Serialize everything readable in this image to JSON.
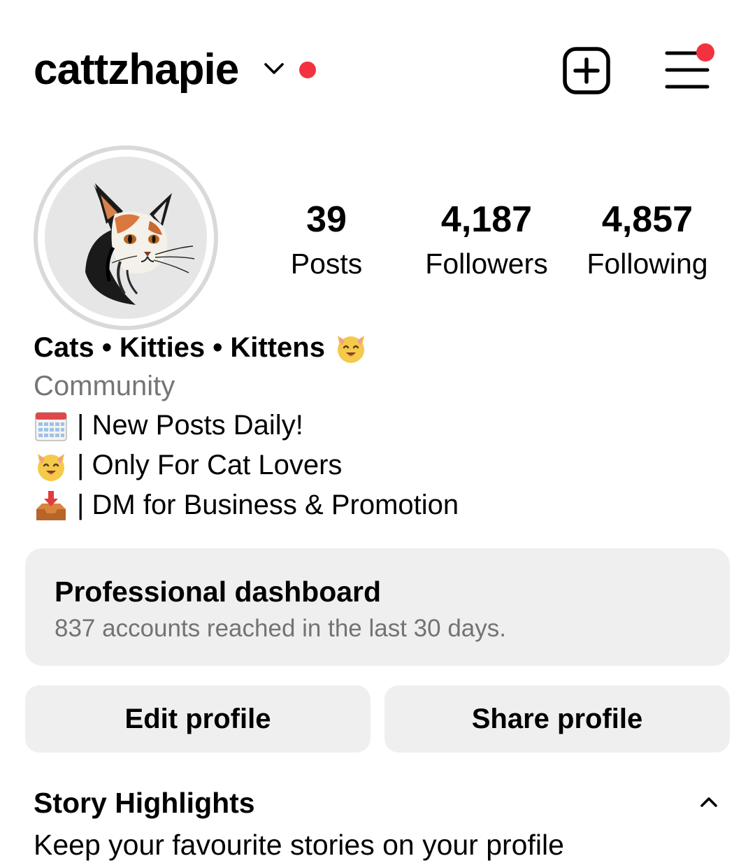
{
  "header": {
    "username": "cattzhapie",
    "icons": {
      "account_switcher": "chevron-down-icon",
      "new_post": "plus-square-icon",
      "menu": "hamburger-menu-icon"
    },
    "notification_color": "#f2333f"
  },
  "profile": {
    "avatar": "cat-portrait-avatar",
    "stats": [
      {
        "value": "39",
        "label": "Posts"
      },
      {
        "value": "4,187",
        "label": "Followers"
      },
      {
        "value": "4,857",
        "label": "Following"
      }
    ]
  },
  "bio": {
    "name": "Cats • Kitties • Kittens",
    "name_emoji": "smiling-cat-emoji",
    "category": "Community",
    "lines": [
      {
        "emoji": "calendar-emoji",
        "text": "| New Posts Daily!"
      },
      {
        "emoji": "smiling-cat-emoji",
        "text": "| Only For Cat Lovers"
      },
      {
        "emoji": "inbox-tray-emoji",
        "text": "| DM for Business & Promotion"
      }
    ]
  },
  "dashboard": {
    "title": "Professional dashboard",
    "subtitle": "837 accounts reached in the last 30 days."
  },
  "actions": {
    "edit_label": "Edit profile",
    "share_label": "Share profile"
  },
  "highlights": {
    "title": "Story Highlights",
    "subtitle": "Keep your favourite stories on your profile",
    "toggle_icon": "chevron-up-icon"
  }
}
